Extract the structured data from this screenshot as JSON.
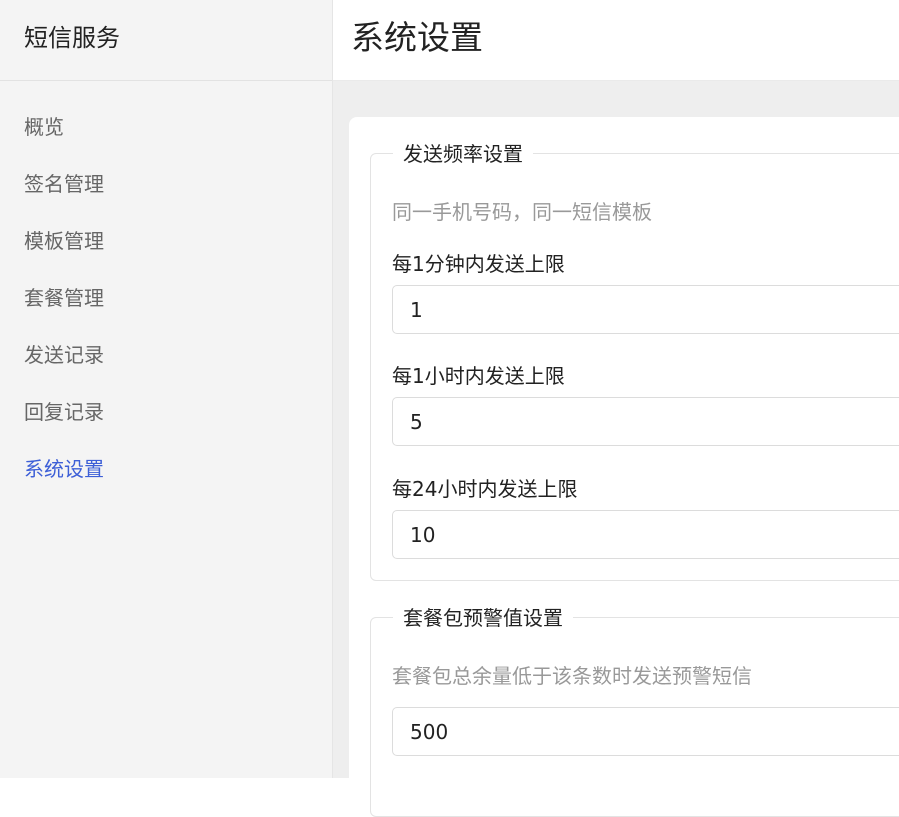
{
  "sidebar": {
    "title": "短信服务",
    "items": [
      {
        "label": "概览"
      },
      {
        "label": "签名管理"
      },
      {
        "label": "模板管理"
      },
      {
        "label": "套餐管理"
      },
      {
        "label": "发送记录"
      },
      {
        "label": "回复记录"
      },
      {
        "label": "系统设置",
        "active": true
      }
    ],
    "active_color": "#3d5fd7"
  },
  "header": {
    "title": "系统设置"
  },
  "frequency": {
    "legend": "发送频率设置",
    "hint": "同一手机号码，同一短信模板",
    "per_minute_label": "每1分钟内发送上限",
    "per_minute_value": "1",
    "per_hour_label": "每1小时内发送上限",
    "per_hour_value": "5",
    "per_day_label": "每24小时内发送上限",
    "per_day_value": "10"
  },
  "package_alert": {
    "legend": "套餐包预警值设置",
    "hint": "套餐包总余量低于该条数时发送预警短信",
    "value": "500"
  }
}
